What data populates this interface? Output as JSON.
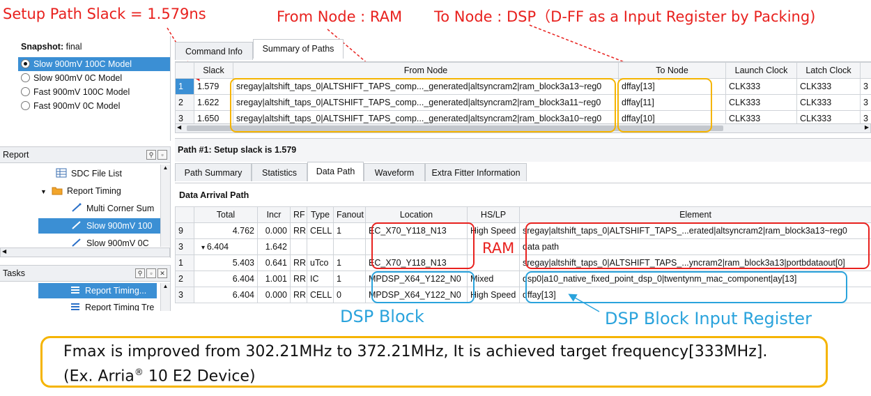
{
  "annotations": {
    "slack": "Setup Path Slack = 1.579ns",
    "from": "From Node : RAM",
    "to": "To Node : DSP（D-FF as a Input Register by Packing)",
    "ram": "RAM",
    "dsp_block": "DSP Block",
    "dsp_input_reg": "DSP Block Input Register"
  },
  "colors": {
    "red": "#e8211e",
    "yellow": "#f5b400",
    "blue": "#2aa3dc",
    "selection": "#3b8fd4"
  },
  "snapshot": {
    "label": "Snapshot:",
    "value": "final",
    "models": [
      "Slow 900mV 100C Model",
      "Slow 900mV 0C Model",
      "Fast 900mV 100C Model",
      "Fast 900mV 0C Model"
    ],
    "selected_index": 0
  },
  "report": {
    "title": "Report",
    "items": [
      {
        "label": "SDC File List",
        "icon": "table-icon"
      },
      {
        "label": "Report Timing",
        "icon": "folder-icon"
      },
      {
        "label": "Multi Corner Sum",
        "icon": "timing-path-icon"
      },
      {
        "label": "Slow 900mV 100",
        "icon": "timing-path-icon"
      },
      {
        "label": "Slow 900mV 0C",
        "icon": "timing-path-icon"
      }
    ]
  },
  "tasks": {
    "title": "Tasks",
    "items": [
      {
        "label": "Report Timing...",
        "icon": "task-list-icon"
      },
      {
        "label": "Report Timing Tre",
        "icon": "task-list-icon"
      }
    ]
  },
  "top_tabs": [
    "Command Info",
    "Summary of Paths"
  ],
  "summary_table": {
    "headers": [
      "",
      "Slack",
      "From Node",
      "To Node",
      "Launch Clock",
      "Latch Clock",
      ""
    ],
    "rows": [
      [
        "1",
        "1.579",
        "sregay|altshift_taps_0|ALTSHIFT_TAPS_comp..._generated|altsyncram2|ram_block3a13~reg0",
        "dffay[13]",
        "CLK333",
        "CLK333",
        "3"
      ],
      [
        "2",
        "1.622",
        "sregay|altshift_taps_0|ALTSHIFT_TAPS_comp..._generated|altsyncram2|ram_block3a11~reg0",
        "dffay[11]",
        "CLK333",
        "CLK333",
        "3"
      ],
      [
        "3",
        "1.650",
        "sregay|altshift_taps_0|ALTSHIFT_TAPS_comp..._generated|altsyncram2|ram_block3a10~reg0",
        "dffay[10]",
        "CLK333",
        "CLK333",
        "3"
      ]
    ]
  },
  "path_title": "Path #1: Setup slack is 1.579",
  "detail_tabs": [
    "Path Summary",
    "Statistics",
    "Data Path",
    "Waveform",
    "Extra Fitter Information"
  ],
  "active_detail_tab": 2,
  "section_title": "Data Arrival Path",
  "arrival_table": {
    "headers": [
      "",
      "Total",
      "Incr",
      "RF",
      "Type",
      "Fanout",
      "Location",
      "HS/LP",
      "Element"
    ],
    "rows": [
      [
        "9",
        "4.762",
        "0.000",
        "RR",
        "CELL",
        "1",
        "EC_X70_Y118_N13",
        "High Speed",
        "sregay|altshift_taps_0|ALTSHIFT_TAPS_...erated|altsyncram2|ram_block3a13~reg0"
      ],
      [
        "3",
        "6.404",
        "1.642",
        "",
        "",
        "",
        "",
        "",
        "data path"
      ],
      [
        "1",
        "5.403",
        "0.641",
        "RR",
        "uTco",
        "1",
        "EC_X70_Y118_N13",
        "",
        "sregay|altshift_taps_0|ALTSHIFT_TAPS_...yncram2|ram_block3a13|portbdataout[0]"
      ],
      [
        "2",
        "6.404",
        "1.001",
        "RR",
        "IC",
        "1",
        "MPDSP_X64_Y122_N0",
        "Mixed",
        "dsp0|a10_native_fixed_point_dsp_0|twentynm_mac_component|ay[13]"
      ],
      [
        "3",
        "6.404",
        "0.000",
        "RR",
        "CELL",
        "0",
        "MPDSP_X64_Y122_N0",
        "High Speed",
        "dffay[13]"
      ]
    ]
  },
  "note": {
    "line1": "Fmax is improved from 302.21MHz to 372.21MHz, It is achieved target frequency[333MHz].",
    "line2_prefix": "(Ex. Arria",
    "line2_sup": "®",
    "line2_suffix": " 10 E2 Device)"
  }
}
